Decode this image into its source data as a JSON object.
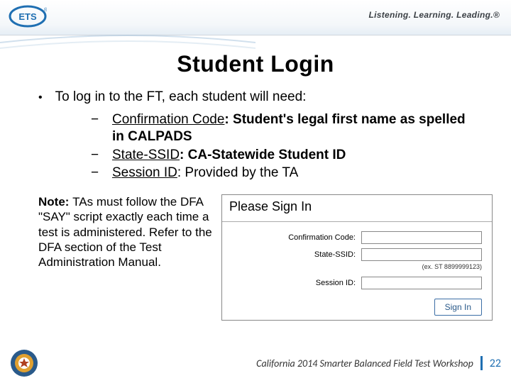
{
  "header": {
    "logo_text": "ETS",
    "tagline": "Listening. Learning. Leading.®"
  },
  "title": "Student Login",
  "intro": "To log in to the FT, each student will need:",
  "items": [
    {
      "label": "Confirmation Code",
      "desc": ": Student's legal first name as spelled in CALPADS"
    },
    {
      "label": "State-SSID",
      "desc": ": CA-Statewide Student ID"
    },
    {
      "label": "Session ID",
      "desc": ": Provided by the TA"
    }
  ],
  "note": {
    "prefix": "Note: ",
    "body": "TAs must follow the DFA \"SAY\" script exactly each time a test is administered. Refer to the DFA section of the Test Administration Manual."
  },
  "signin": {
    "title": "Please Sign In",
    "fields": {
      "confirmation": "Confirmation Code:",
      "state_ssid": "State-SSID:",
      "state_hint": "(ex. ST 8899999123)",
      "session": "Session ID:"
    },
    "button": "Sign In"
  },
  "footer": {
    "text": "California 2014 Smarter Balanced Field Test Workshop",
    "page": "22"
  }
}
